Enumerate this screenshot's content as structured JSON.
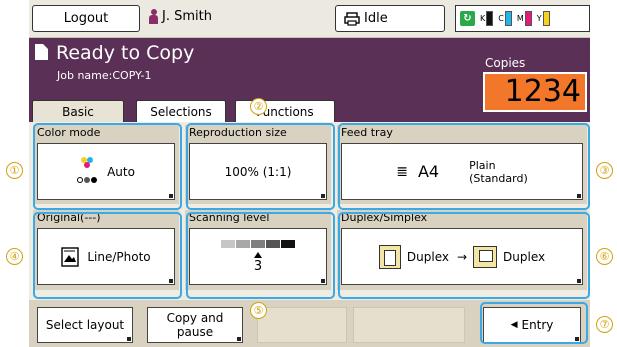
{
  "topbar": {
    "logout_label": "Logout",
    "user_name": "J. Smith",
    "status_label": "Idle",
    "inks": [
      {
        "label": "K",
        "color": "#111111"
      },
      {
        "label": "C",
        "color": "#1fb6e8"
      },
      {
        "label": "M",
        "color": "#e8187a"
      },
      {
        "label": "Y",
        "color": "#f7d21a"
      }
    ]
  },
  "header": {
    "title": "Ready to Copy",
    "job_name": "Job name:COPY-1",
    "copies_label": "Copies",
    "copies_value": "1234"
  },
  "tabs": [
    {
      "label": "Basic"
    },
    {
      "label": "Selections"
    },
    {
      "label": "Functions"
    }
  ],
  "tiles": {
    "color_mode": {
      "title": "Color mode",
      "value": "Auto"
    },
    "reproduction_size": {
      "title": "Reproduction size",
      "value": "100% (1:1)"
    },
    "feed_tray": {
      "title": "Feed tray",
      "size": "A4",
      "paper_type_line1": "Plain",
      "paper_type_line2": "(Standard)"
    },
    "original": {
      "title": "Original(---)",
      "value": "Line/Photo"
    },
    "scanning_level": {
      "title": "Scanning level",
      "value": "3"
    },
    "duplex_simplex": {
      "title": "Duplex/Simplex",
      "from": "Duplex",
      "to": "Duplex"
    }
  },
  "bottombar": {
    "select_layout_label": "Select layout",
    "copy_pause_line1": "Copy and",
    "copy_pause_line2": "pause",
    "entry_label": "Entry"
  },
  "callouts": [
    "①",
    "②",
    "③",
    "④",
    "⑤",
    "⑥",
    "⑦"
  ],
  "colors": {
    "panel": "#5b3056",
    "copies_bg": "#f2772a",
    "highlight": "#3aa9e6",
    "callout": "#d4a10a"
  }
}
